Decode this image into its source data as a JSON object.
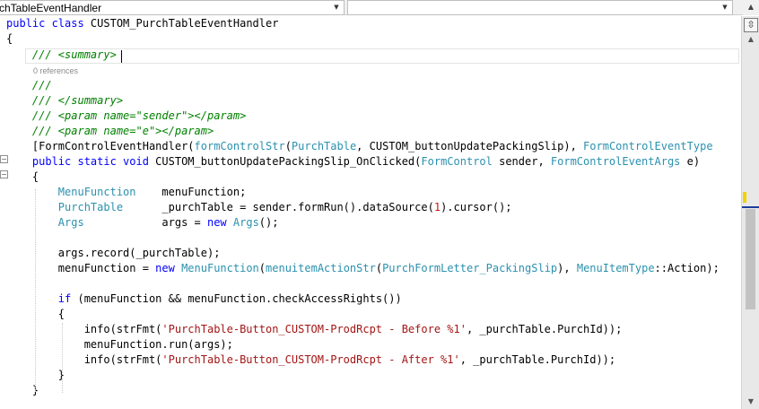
{
  "navigation_bar": {
    "type_combo_text": "chTableEventHandler",
    "member_combo_text": ""
  },
  "editor": {
    "reference_text": "0 references",
    "lines": [
      [
        {
          "c": "kw",
          "t": "public class "
        },
        {
          "c": "",
          "t": "CUSTOM_PurchTableEventHandler"
        }
      ],
      [
        {
          "c": "",
          "t": "{"
        }
      ],
      [
        {
          "c": "cm",
          "t": "    /// <summary>"
        }
      ],
      [
        {
          "c": "cm",
          "t": "    ///"
        }
      ],
      [
        {
          "c": "cm",
          "t": "    /// </summary>"
        }
      ],
      [
        {
          "c": "cm",
          "t": "    /// <param name=\"sender\"></param>"
        }
      ],
      [
        {
          "c": "cm",
          "t": "    /// <param name=\"e\"></param>"
        }
      ],
      [
        {
          "c": "",
          "t": "    ["
        },
        {
          "c": "",
          "t": "FormControlEventHandler"
        },
        {
          "c": "",
          "t": "("
        },
        {
          "c": "ty",
          "t": "formControlStr"
        },
        {
          "c": "",
          "t": "("
        },
        {
          "c": "ty",
          "t": "PurchTable"
        },
        {
          "c": "",
          "t": ", CUSTOM_buttonUpdatePackingSlip), "
        },
        {
          "c": "ty",
          "t": "FormControlEventType"
        }
      ],
      [
        {
          "c": "kw",
          "t": "    public static void "
        },
        {
          "c": "",
          "t": "CUSTOM_buttonUpdatePackingSlip_OnClicked("
        },
        {
          "c": "ty",
          "t": "FormControl"
        },
        {
          "c": "",
          "t": " sender, "
        },
        {
          "c": "ty",
          "t": "FormControlEventArgs"
        },
        {
          "c": "",
          "t": " e)"
        }
      ],
      [
        {
          "c": "",
          "t": "    {"
        }
      ],
      [
        {
          "c": "ty",
          "t": "        MenuFunction"
        },
        {
          "c": "",
          "t": "    menuFunction;"
        }
      ],
      [
        {
          "c": "ty",
          "t": "        PurchTable"
        },
        {
          "c": "",
          "t": "      _purchTable = sender.formRun().dataSource("
        },
        {
          "c": "nm",
          "t": "1"
        },
        {
          "c": "",
          "t": ").cursor();"
        }
      ],
      [
        {
          "c": "ty",
          "t": "        Args"
        },
        {
          "c": "",
          "t": "            args = "
        },
        {
          "c": "kw",
          "t": "new "
        },
        {
          "c": "ty",
          "t": "Args"
        },
        {
          "c": "",
          "t": "();"
        }
      ],
      [
        {
          "c": "",
          "t": ""
        }
      ],
      [
        {
          "c": "",
          "t": "        args.record(_purchTable);"
        }
      ],
      [
        {
          "c": "",
          "t": "        menuFunction = "
        },
        {
          "c": "kw",
          "t": "new "
        },
        {
          "c": "ty",
          "t": "MenuFunction"
        },
        {
          "c": "",
          "t": "("
        },
        {
          "c": "ty",
          "t": "menuitemActionStr"
        },
        {
          "c": "",
          "t": "("
        },
        {
          "c": "ty",
          "t": "PurchFormLetter_PackingSlip"
        },
        {
          "c": "",
          "t": "), "
        },
        {
          "c": "ty",
          "t": "MenuItemType"
        },
        {
          "c": "",
          "t": "::Action);"
        }
      ],
      [
        {
          "c": "",
          "t": ""
        }
      ],
      [
        {
          "c": "kw",
          "t": "        if "
        },
        {
          "c": "",
          "t": "(menuFunction && menuFunction.checkAccessRights())"
        }
      ],
      [
        {
          "c": "",
          "t": "        {"
        }
      ],
      [
        {
          "c": "",
          "t": "            info(strFmt("
        },
        {
          "c": "st",
          "t": "'PurchTable-Button_CUSTOM-ProdRcpt - Before %1'"
        },
        {
          "c": "",
          "t": ", _purchTable.PurchId));"
        }
      ],
      [
        {
          "c": "",
          "t": "            menuFunction.run(args);"
        }
      ],
      [
        {
          "c": "",
          "t": "            info(strFmt("
        },
        {
          "c": "st",
          "t": "'PurchTable-Button_CUSTOM-ProdRcpt - After %1'"
        },
        {
          "c": "",
          "t": ", _purchTable.PurchId));"
        }
      ],
      [
        {
          "c": "",
          "t": "        }"
        }
      ],
      [
        {
          "c": "",
          "t": "    }"
        }
      ]
    ]
  },
  "colors": {
    "keyword": "#0000ff",
    "type": "#2b91af",
    "comment": "#008000",
    "string": "#a31515",
    "number": "#c8161d"
  },
  "icons": {
    "dropdown": "chevron-down-icon",
    "collapse": "collapse-minus-icon",
    "split": "split-window-icon",
    "scroll_up": "arrow-up-icon",
    "scroll_down": "arrow-down-icon"
  }
}
